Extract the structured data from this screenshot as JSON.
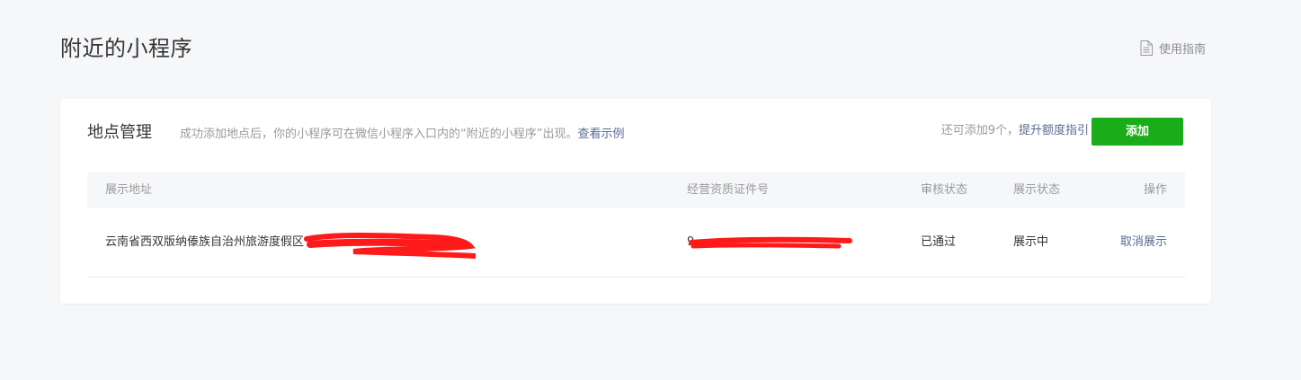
{
  "header": {
    "title": "附近的小程序",
    "guide_label": "使用指南",
    "guide_icon": "document-icon"
  },
  "section": {
    "title": "地点管理",
    "desc": "成功添加地点后，你的小程序可在微信小程序入口内的“附近的小程序”出现。",
    "example_link": "查看示例",
    "quota_text": "还可添加9个，",
    "quota_link": "提升额度指引",
    "add_button": "添加"
  },
  "table": {
    "columns": [
      "展示地址",
      "经营资质证件号",
      "审核状态",
      "展示状态",
      "操作"
    ],
    "rows": [
      {
        "address": "云南省西双版纳傣族自治州旅游度假区",
        "license": "9",
        "audit_status": "已通过",
        "display_status": "展示中",
        "action": "取消展示"
      }
    ]
  },
  "colors": {
    "primary_green": "#1aad19",
    "link_blue": "#576b95",
    "redaction_red": "#ff1a1a"
  }
}
